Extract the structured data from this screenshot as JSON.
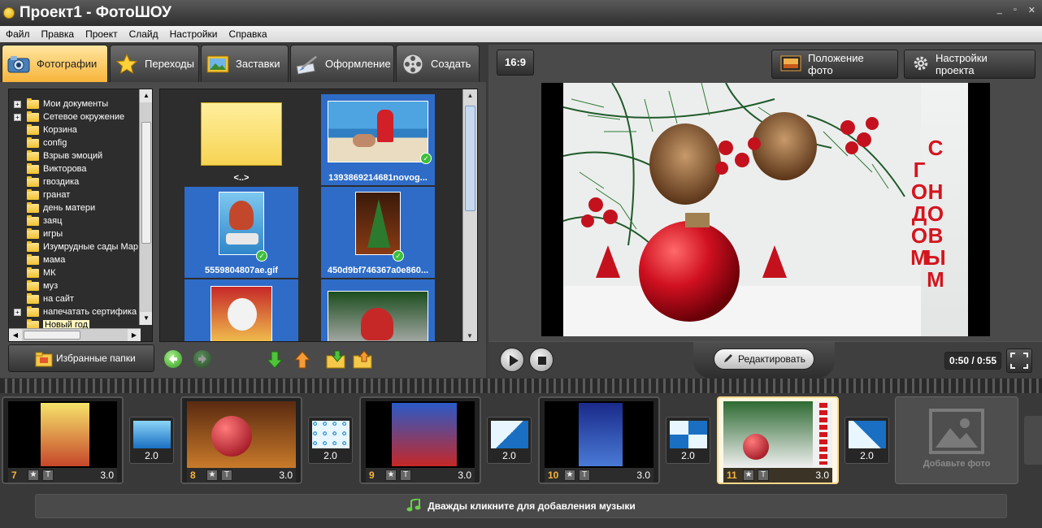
{
  "window": {
    "title": "Проект1 - ФотоШОУ",
    "minimize": "_",
    "maximize": "▫",
    "close": "✕"
  },
  "menu": [
    "Файл",
    "Правка",
    "Проект",
    "Слайд",
    "Настройки",
    "Справка"
  ],
  "tabs": [
    {
      "label": "Фотографии",
      "icon": "camera-icon"
    },
    {
      "label": "Переходы",
      "icon": "star-icon"
    },
    {
      "label": "Заставки",
      "icon": "picture-icon"
    },
    {
      "label": "Оформление",
      "icon": "brush-icon"
    },
    {
      "label": "Создать",
      "icon": "film-reel-icon"
    }
  ],
  "tree": [
    {
      "label": "Мои документы",
      "expand": "+"
    },
    {
      "label": "Сетевое окружение",
      "expand": "+"
    },
    {
      "label": "Корзина"
    },
    {
      "label": "config"
    },
    {
      "label": "Взрыв эмоций"
    },
    {
      "label": "Викторова"
    },
    {
      "label": "гвоздика"
    },
    {
      "label": "гранат"
    },
    {
      "label": "день матери"
    },
    {
      "label": "заяц"
    },
    {
      "label": "игры"
    },
    {
      "label": "Изумрудные сады Мар"
    },
    {
      "label": "мама"
    },
    {
      "label": "МК"
    },
    {
      "label": "муз"
    },
    {
      "label": "на сайт"
    },
    {
      "label": "напечатать сертифика",
      "expand": "+"
    },
    {
      "label": "Новый год",
      "selected": true
    }
  ],
  "scroll_arrows": {
    "up": "▲",
    "down": "▼",
    "left": "◀",
    "right": "▶"
  },
  "thumbnails": [
    {
      "caption": "<..>"
    },
    {
      "caption": "1393869214681novog..."
    },
    {
      "caption": "5559804807ae.gif"
    },
    {
      "caption": "450d9bf746367a0e860..."
    },
    {
      "caption": ""
    },
    {
      "caption": ""
    }
  ],
  "check_mark": "✓",
  "favorites_label": "Избранные папки",
  "aspect_ratio": "16:9",
  "photo_position_label": "Положение фото",
  "project_settings_label": "Настройки проекта",
  "preview_text": "С НОВЫМ ГОДОМ",
  "edit_label": "Редактировать",
  "time_display": "0:50 / 0:55",
  "slides": [
    {
      "num": "7",
      "duration": "3.0",
      "star": "★",
      "text": "T"
    },
    {
      "num": "8",
      "duration": "3.0",
      "star": "★",
      "text": "T"
    },
    {
      "num": "9",
      "duration": "3.0",
      "star": "★",
      "text": "T"
    },
    {
      "num": "10",
      "duration": "3.0",
      "star": "★",
      "text": "T"
    },
    {
      "num": "11",
      "duration": "3.0",
      "star": "★",
      "text": "T"
    }
  ],
  "transitions": [
    "2.0",
    "2.0",
    "2.0",
    "2.0",
    "2.0"
  ],
  "add_photo_label": "Добавьте фото",
  "music_hint": "Дважды кликните для добавления музыки",
  "timeline_left_arrow": "‹",
  "colors": {
    "accent_orange": "#f7b43a",
    "selection_blue": "#2e6cc7",
    "greeting_red": "#d4151e"
  }
}
